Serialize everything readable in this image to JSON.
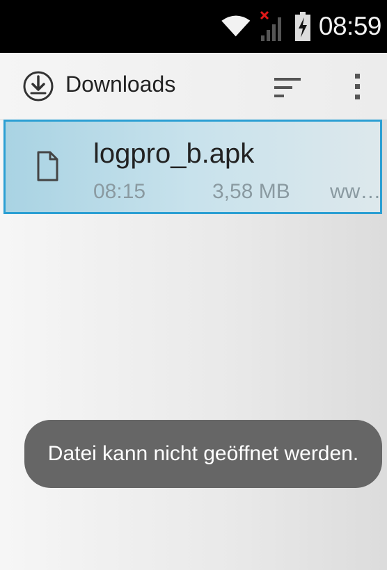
{
  "status_bar": {
    "time": "08:59",
    "icons": [
      "wifi-icon",
      "no-signal-icon",
      "battery-charging-icon"
    ]
  },
  "action_bar": {
    "title": "Downloads",
    "icons": [
      "download-icon",
      "sort-icon",
      "overflow-menu-icon"
    ]
  },
  "downloads": {
    "items": [
      {
        "name": "logpro_b.apk",
        "time": "08:15",
        "size": "3,58 MB",
        "source": "ww…",
        "icon": "file-icon"
      }
    ]
  },
  "toast": {
    "message": "Datei kann nicht geöffnet werden."
  },
  "colors": {
    "selection_border": "#2b9fd3",
    "selection_fill": "#a9d3e3",
    "toast_background": "#666666",
    "status_bar": "#000000"
  }
}
